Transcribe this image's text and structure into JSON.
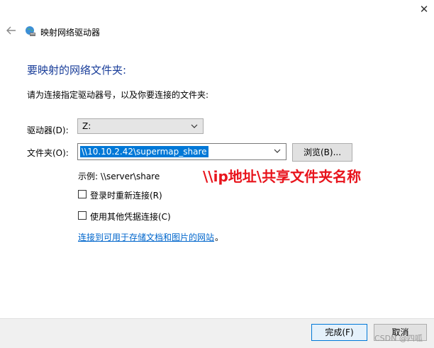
{
  "window": {
    "title": "映射网络驱动器",
    "close_glyph": "✕"
  },
  "heading": "要映射的网络文件夹:",
  "instruction": "请为连接指定驱动器号，以及你要连接的文件夹:",
  "drive": {
    "label": "驱动器(D):",
    "value": "Z:"
  },
  "folder": {
    "label": "文件夹(O):",
    "value": "\\\\10.10.2.42\\supermap_share"
  },
  "browse_label": "浏览(B)...",
  "example": "示例: \\\\server\\share",
  "annotation": "\\\\ip地址\\共享文件夹名称",
  "checkboxes": [
    {
      "label": "登录时重新连接(R)",
      "checked": false
    },
    {
      "label": "使用其他凭据连接(C)",
      "checked": false
    }
  ],
  "link": {
    "text": "连接到可用于存储文档和图片的网站",
    "suffix": "。"
  },
  "footer": {
    "finish_label": "完成(F)",
    "cancel_label": "取消"
  },
  "watermark": "CSDN @四呱",
  "colors": {
    "heading": "#1a3e9a",
    "annotation": "#e8141c",
    "selection": "#0078d7",
    "link": "#0066cc"
  }
}
